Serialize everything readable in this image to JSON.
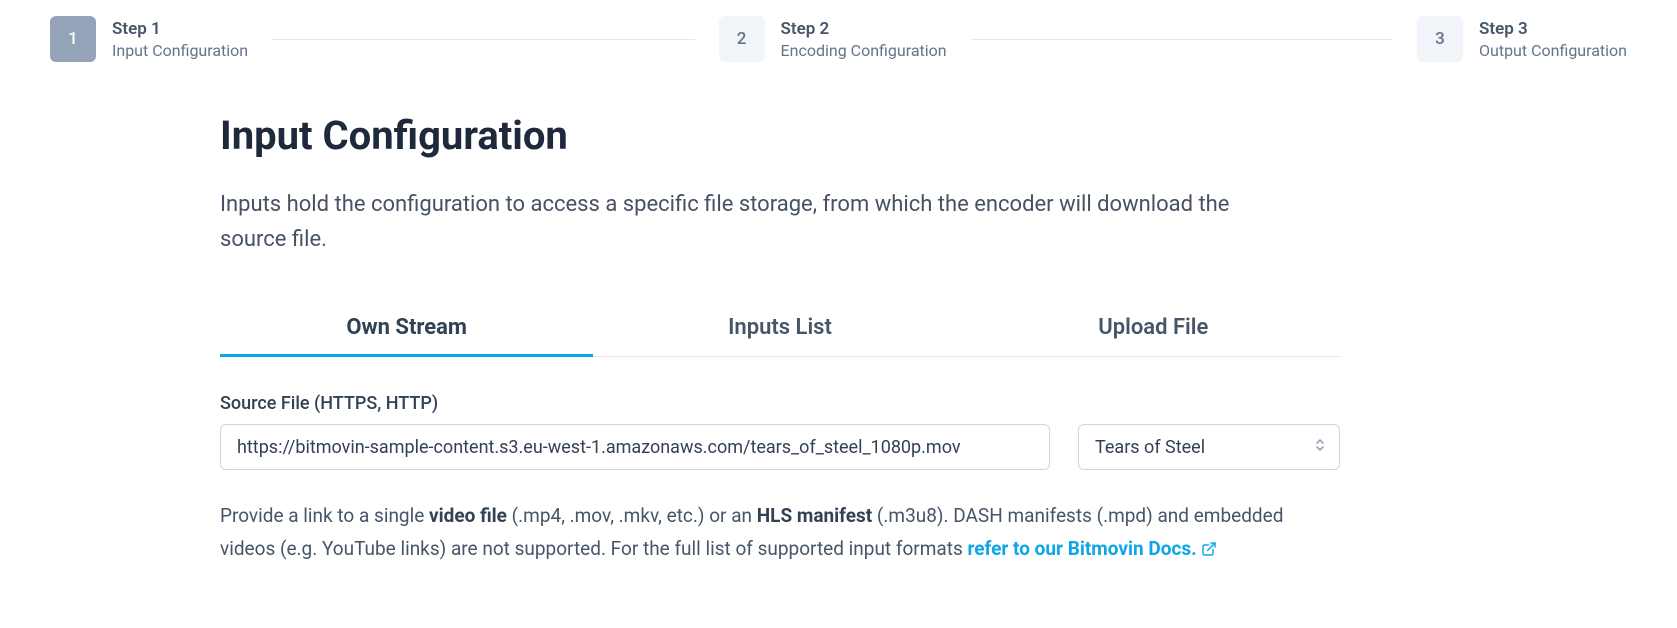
{
  "stepper": {
    "steps": [
      {
        "number": "1",
        "title": "Step 1",
        "subtitle": "Input Configuration",
        "active": true
      },
      {
        "number": "2",
        "title": "Step 2",
        "subtitle": "Encoding Configuration",
        "active": false
      },
      {
        "number": "3",
        "title": "Step 3",
        "subtitle": "Output Configuration",
        "active": false
      }
    ]
  },
  "page": {
    "title": "Input Configuration",
    "description": "Inputs hold the configuration to access a specific file storage, from which the encoder will download the source file."
  },
  "tabs": {
    "items": [
      {
        "label": "Own Stream",
        "active": true
      },
      {
        "label": "Inputs List",
        "active": false
      },
      {
        "label": "Upload File",
        "active": false
      }
    ]
  },
  "form": {
    "source_label": "Source File (HTTPS, HTTP)",
    "source_value": "https://bitmovin-sample-content.s3.eu-west-1.amazonaws.com/tears_of_steel_1080p.mov",
    "preset_selected": "Tears of Steel"
  },
  "help": {
    "t1": "Provide a link to a single ",
    "t2": "video file",
    "t3": " (.mp4, .mov, .mkv, etc.) or an ",
    "t4": "HLS manifest",
    "t5": " (.m3u8). DASH manifests (.mpd) and embedded videos (e.g. YouTube links) are not supported. For the full list of supported input formats ",
    "link": "refer to our Bitmovin Docs."
  }
}
